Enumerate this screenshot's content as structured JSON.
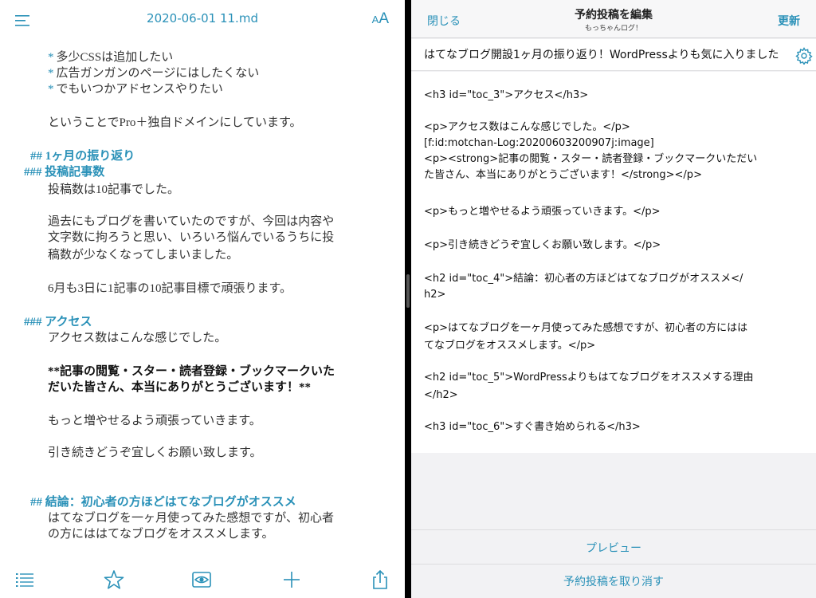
{
  "left": {
    "doc_title": "2020-06-01 11.md",
    "font_button": {
      "small": "A",
      "big": "A"
    },
    "lines": [
      {
        "bullet": "*",
        "text": "多少CSSは追加したい"
      },
      {
        "bullet": "*",
        "text": "広告ガンガンのページにはしたくない"
      },
      {
        "bullet": "*",
        "text": "でもいつかアドセンスやりたい"
      },
      {
        "text": "ということでPro＋独自ドメインにしています。"
      },
      {
        "text": "## 1ヶ月の振り返り"
      },
      {
        "text": "### 投稿記事数"
      },
      {
        "text": "投稿数は10記事でした。"
      },
      {
        "text": "過去にもブログを書いていたのですが、今回は内容や"
      },
      {
        "text": "文字数に拘ろうと思い、いろいろ悩んでいるうちに投"
      },
      {
        "text": "稿数が少なくなってしまいました。"
      },
      {
        "text": "6月も3日に1記事の10記事目標で頑張ります。"
      },
      {
        "text": "### アクセス"
      },
      {
        "text": "アクセス数はこんな感じでした。"
      },
      {
        "text": "**記事の閲覧・スター・読者登録・ブックマークいた"
      },
      {
        "text": "だいた皆さん、本当にありがとうございます！**"
      },
      {
        "text": "もっと増やせるよう頑張っていきます。"
      },
      {
        "text": "引き続きどうぞ宜しくお願い致します。"
      },
      {
        "text": "## 結論：初心者の方ほどはてなブログがオススメ"
      },
      {
        "text": "はてなブログを一ヶ月使ってみた感想ですが、初心者"
      },
      {
        "text": "の方にははてなブログをオススメします。"
      }
    ]
  },
  "right": {
    "close_label": "閉じる",
    "nav_title": "予約投稿を編集",
    "nav_subtitle": "もっちゃんログ！",
    "update_label": "更新",
    "post_title": "はてなブログ開設1ヶ月の振り返り！WordPressよりも気に入りました",
    "body_lines": [
      "<h3 id=\"toc_3\">アクセス</h3>",
      "<p>アクセス数はこんな感じでした。</p>",
      "[f:id:motchan-Log:20200603200907j:image]",
      "<p><strong>記事の閲覧・スター・読者登録・ブックマークいただい",
      "た皆さん、本当にありがとうございます！</strong></p>",
      "<p>もっと増やせるよう頑張っていきます。</p>",
      "<p>引き続きどうぞ宜しくお願い致します。</p>",
      "<h2 id=\"toc_4\">結論：初心者の方ほどはてなブログがオススメ</",
      "h2>",
      "<p>はてなブログを一ヶ月使ってみた感想ですが、初心者の方にはは",
      "てなブログをオススメします。</p>",
      "<h2 id=\"toc_5\">WordPressよりもはてなブログをオススメする理由",
      "</h2>",
      "<h3 id=\"toc_6\">すぐ書き始められる</h3>"
    ],
    "preview_label": "プレビュー",
    "cancel_label": "予約投稿を取り消す"
  },
  "colors": {
    "accent": "#2a91b8",
    "pane_bg": "#ffffff",
    "panel_bg": "#f2f2f4"
  },
  "icons": [
    "menu-icon",
    "font-size-icon",
    "list-icon",
    "star-icon",
    "eye-icon",
    "plus-icon",
    "share-icon",
    "gear-icon"
  ]
}
